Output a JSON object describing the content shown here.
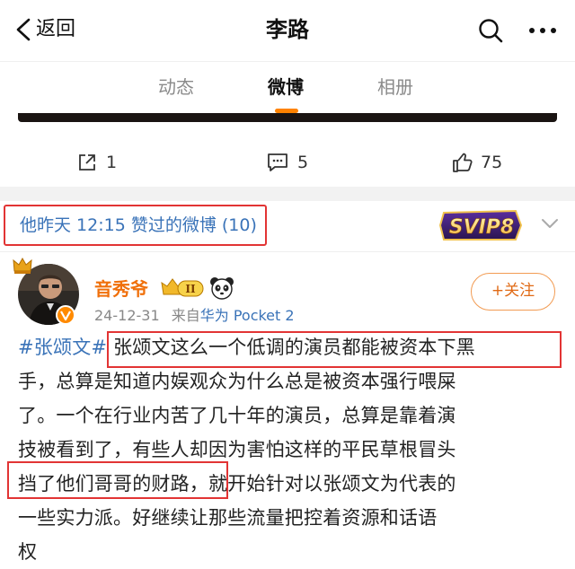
{
  "header": {
    "back_label": "返回",
    "title": "李路"
  },
  "tabs": [
    {
      "label": "动态",
      "active": false
    },
    {
      "label": "微博",
      "active": true
    },
    {
      "label": "相册",
      "active": false
    }
  ],
  "actions": {
    "share_count": "1",
    "comment_count": "5",
    "like_count": "75"
  },
  "liked_section": {
    "text": "他昨天 12:15 赞过的微博 (10)",
    "vip_badge": "SVIP8"
  },
  "post": {
    "username": "音秀爷",
    "level_badge": "II",
    "date": "24-12-31",
    "source_prefix": "来自",
    "source": "华为 Pocket 2",
    "follow_label": "+关注",
    "hashtag": "#张颂文#",
    "lines": [
      " 张颂文这么一个低调的演员都能被资本下黑",
      "手，总算是知道内娱观众为什么总是被资本强行喂屎",
      "了。一个在行业内苦了几十年的演员，总算是靠着演",
      "技被看到了，有些人却因为害怕这样的平民草根冒头",
      "挡了他们哥哥的财路，就开始针对以张颂文为代表的",
      "一些实力派。好继续让那些流量把控着资源和话语",
      "权"
    ]
  },
  "colors": {
    "accent": "#ff8200",
    "link": "#3a73b8",
    "highlight_box": "#e23434",
    "username": "#f0700b"
  },
  "icons": [
    "back-icon",
    "search-icon",
    "more-icon",
    "share-icon",
    "comment-icon",
    "like-icon",
    "chevron-down-icon",
    "crown-icon",
    "verified-badge-icon",
    "panda-icon"
  ]
}
